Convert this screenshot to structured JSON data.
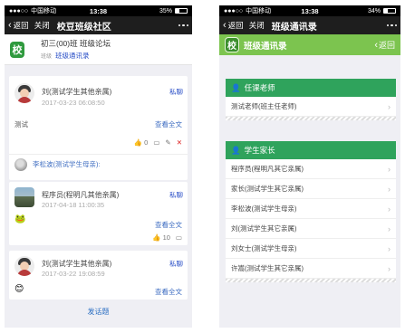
{
  "left": {
    "status": {
      "signal": "●●●○○",
      "carrier": "中国移动",
      "time": "13:38",
      "battery": "35%",
      "battery_level": 0.35
    },
    "nav": {
      "back": "返回",
      "close": "关闭",
      "title": "校豆班级社区"
    },
    "header": {
      "logo": "校",
      "class_name": "初三(00)班 班级论坛",
      "sub_label": "班级",
      "roster_link": "班级通讯录"
    },
    "posts": [
      {
        "name": "刘(测试学生其他亲属)",
        "date": "2017-03-23 06:08:50",
        "pm": "私聊",
        "text": "测试",
        "more": "查看全文",
        "likes": "0",
        "comment": "李松波(测试学生母亲):"
      },
      {
        "name": "程序员(程明凡其他亲属)",
        "date": "2017-04-18 11:00:35",
        "pm": "私聊",
        "more": "查看全文",
        "likes": "10"
      },
      {
        "name": "刘(测试学生其他亲属)",
        "date": "2017-03-22 19:08:59",
        "pm": "私聊",
        "more": "查看全文"
      }
    ],
    "compose": "发话题"
  },
  "right": {
    "status": {
      "signal": "●●●○○",
      "carrier": "中国移动",
      "time": "13:38",
      "battery": "34%",
      "battery_level": 0.34
    },
    "nav": {
      "back": "返回",
      "close": "关闭",
      "title": "班级通讯录"
    },
    "subnav": {
      "logo": "校",
      "title": "班级通讯录",
      "back": "返回"
    },
    "teachers": {
      "heading": "任课老师",
      "items": [
        "测试老师(班主任老师)"
      ]
    },
    "parents": {
      "heading": "学生家长",
      "items": [
        "程序员(程明凡其它亲属)",
        "家长(测试学生其它亲属)",
        "李松波(测试学生母亲)",
        "刘(测试学生其它亲属)",
        "刘女士(测试学生母亲)",
        "许嵩(测试学生其它亲属)"
      ]
    }
  }
}
